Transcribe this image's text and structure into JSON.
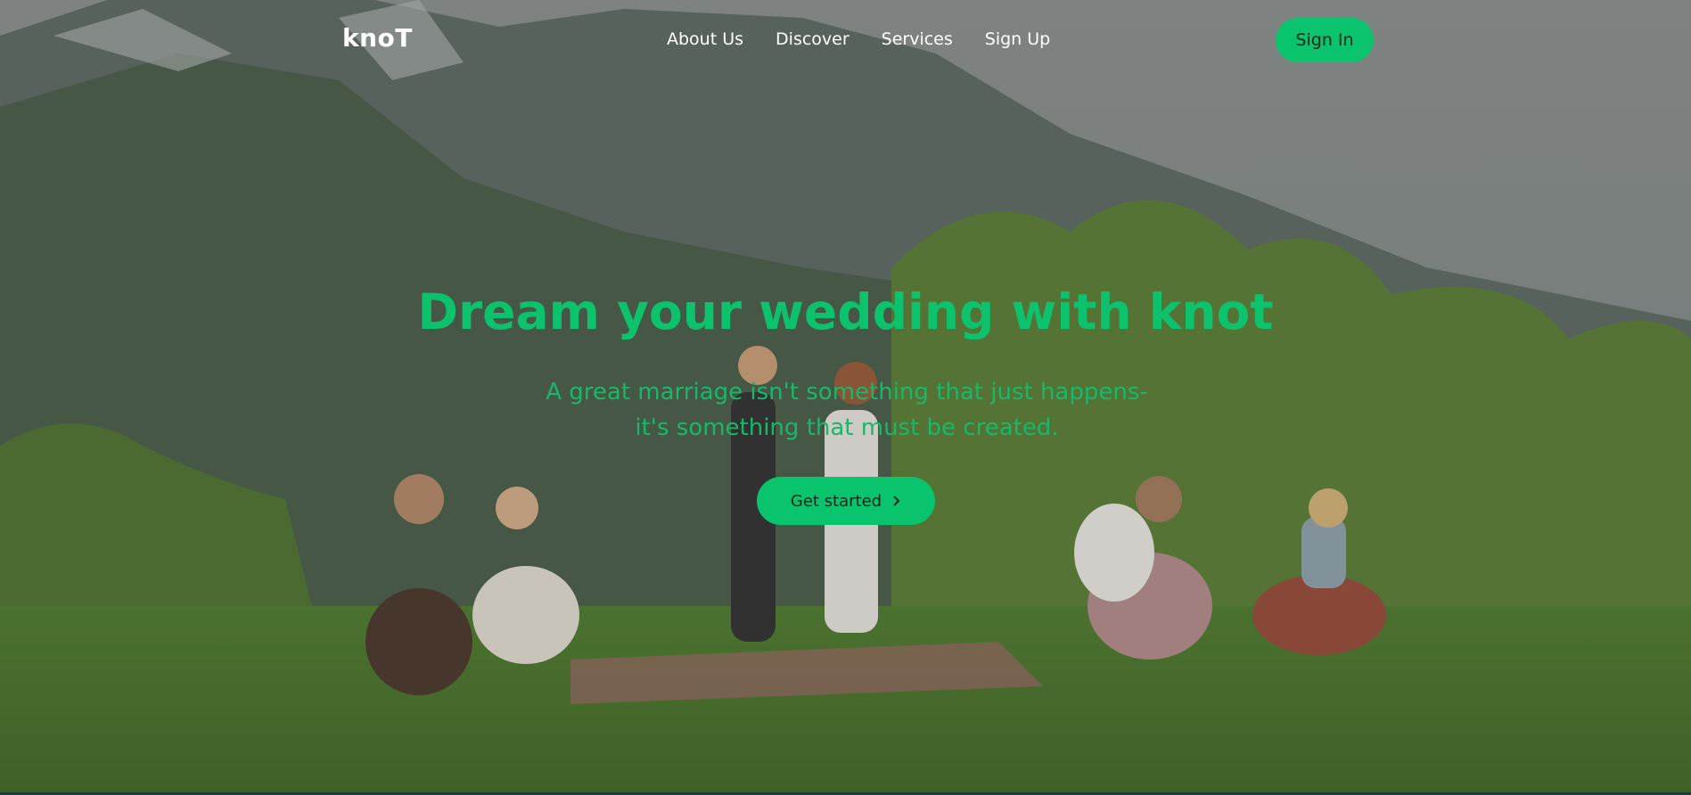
{
  "brand": {
    "logo_text": "knoT"
  },
  "nav": {
    "items": [
      {
        "label": "About Us"
      },
      {
        "label": "Discover"
      },
      {
        "label": "Services"
      },
      {
        "label": "Sign Up"
      }
    ],
    "sign_in_label": "Sign In"
  },
  "hero": {
    "title": "Dream your wedding with knot",
    "subtitle": "A great marriage isn't something that just happens- it's something that must be created.",
    "cta_label": "Get started",
    "cta_icon": "chevron-right-icon",
    "background_description_icon": "hero-photo"
  },
  "colors": {
    "accent": "#0ac36d",
    "headline": "#0cc26c",
    "nav_text": "#ffffff"
  }
}
